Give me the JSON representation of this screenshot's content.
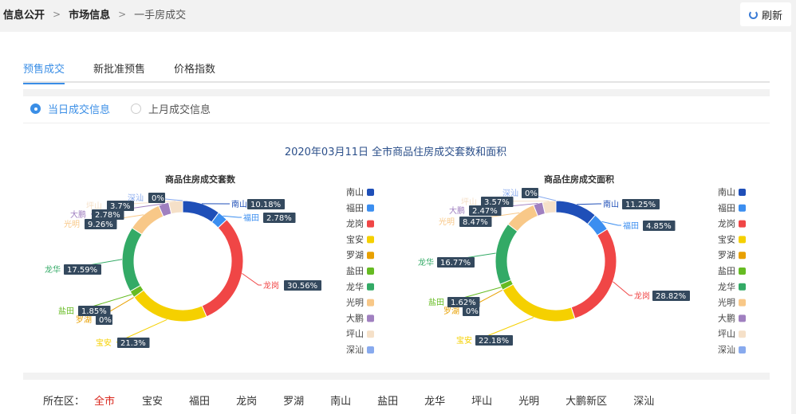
{
  "breadcrumb": {
    "level1": "信息公开",
    "level2": "市场信息",
    "current": "一手房成交"
  },
  "refresh_label": "刷新",
  "tabs": [
    {
      "label": "预售成交",
      "active": true
    },
    {
      "label": "新批准预售",
      "active": false
    },
    {
      "label": "价格指数",
      "active": false
    }
  ],
  "radios": [
    {
      "label": "当日成交信息",
      "checked": true
    },
    {
      "label": "上月成交信息",
      "checked": false
    }
  ],
  "chart_heading": "2020年03月11日 全市商品住房成交套数和面积",
  "colors": {
    "南山": "#1f4fb8",
    "福田": "#3b8ef0",
    "龙岗": "#f04646",
    "宝安": "#f5d000",
    "罗湖": "#e8a000",
    "盐田": "#66bb22",
    "龙华": "#33aa66",
    "光明": "#f8c888",
    "大鹏": "#a080c0",
    "坪山": "#f5e0c8",
    "深汕": "#88aaee"
  },
  "chart_data": [
    {
      "type": "pie",
      "title": "商品住房成交套数",
      "legend": [
        "南山",
        "福田",
        "龙岗",
        "宝安",
        "罗湖",
        "盐田",
        "龙华",
        "光明",
        "大鹏",
        "坪山",
        "深汕"
      ],
      "legend_position": "right",
      "slices": [
        {
          "name": "南山",
          "value": 10.18,
          "label": "10.18%"
        },
        {
          "name": "福田",
          "value": 2.78,
          "label": "2.78%"
        },
        {
          "name": "龙岗",
          "value": 30.56,
          "label": "30.56%"
        },
        {
          "name": "宝安",
          "value": 21.3,
          "label": "21.3%"
        },
        {
          "name": "罗湖",
          "value": 0,
          "label": "0%"
        },
        {
          "name": "盐田",
          "value": 1.85,
          "label": "1.85%"
        },
        {
          "name": "龙华",
          "value": 17.59,
          "label": "17.59%"
        },
        {
          "name": "光明",
          "value": 9.26,
          "label": "9.26%"
        },
        {
          "name": "大鹏",
          "value": 2.78,
          "label": "2.78%"
        },
        {
          "name": "坪山",
          "value": 3.7,
          "label": "3.7%"
        },
        {
          "name": "深汕",
          "value": 0,
          "label": "0%"
        }
      ]
    },
    {
      "type": "pie",
      "title": "商品住房成交面积",
      "legend": [
        "南山",
        "福田",
        "龙岗",
        "宝安",
        "罗湖",
        "盐田",
        "龙华",
        "光明",
        "大鹏",
        "坪山",
        "深汕"
      ],
      "legend_position": "right",
      "slices": [
        {
          "name": "南山",
          "value": 11.25,
          "label": "11.25%"
        },
        {
          "name": "福田",
          "value": 4.85,
          "label": "4.85%"
        },
        {
          "name": "龙岗",
          "value": 28.82,
          "label": "28.82%"
        },
        {
          "name": "宝安",
          "value": 22.18,
          "label": "22.18%"
        },
        {
          "name": "罗湖",
          "value": 0,
          "label": "0%"
        },
        {
          "name": "盐田",
          "value": 1.62,
          "label": "1.62%"
        },
        {
          "name": "龙华",
          "value": 16.77,
          "label": "16.77%"
        },
        {
          "name": "光明",
          "value": 8.47,
          "label": "8.47%"
        },
        {
          "name": "大鹏",
          "value": 2.47,
          "label": "2.47%"
        },
        {
          "name": "坪山",
          "value": 3.57,
          "label": "3.57%"
        },
        {
          "name": "深汕",
          "value": 0,
          "label": "0%"
        }
      ]
    }
  ],
  "district_filter": {
    "label": "所在区：",
    "items": [
      "全市",
      "宝安",
      "福田",
      "龙岗",
      "罗湖",
      "南山",
      "盐田",
      "龙华",
      "坪山",
      "光明",
      "大鹏新区",
      "深汕"
    ],
    "active": "全市"
  }
}
